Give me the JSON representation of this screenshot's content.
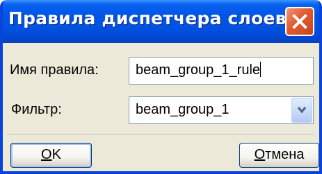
{
  "window": {
    "title": "Правила диспетчера слоев"
  },
  "titlebar": {
    "close_icon": "close-icon",
    "close_color": "#e05a2e",
    "accent": "#0054e3"
  },
  "form": {
    "rule_name_label": "Имя правила:",
    "rule_name_value": "beam_group_1_rule",
    "filter_label": "Фильтр:",
    "filter_value": "beam_group_1",
    "filter_arrow_icon": "chevron-down-icon"
  },
  "buttons": {
    "ok_accel": "O",
    "ok_rest": "K",
    "cancel_accel": "О",
    "cancel_rest": "тмена"
  }
}
